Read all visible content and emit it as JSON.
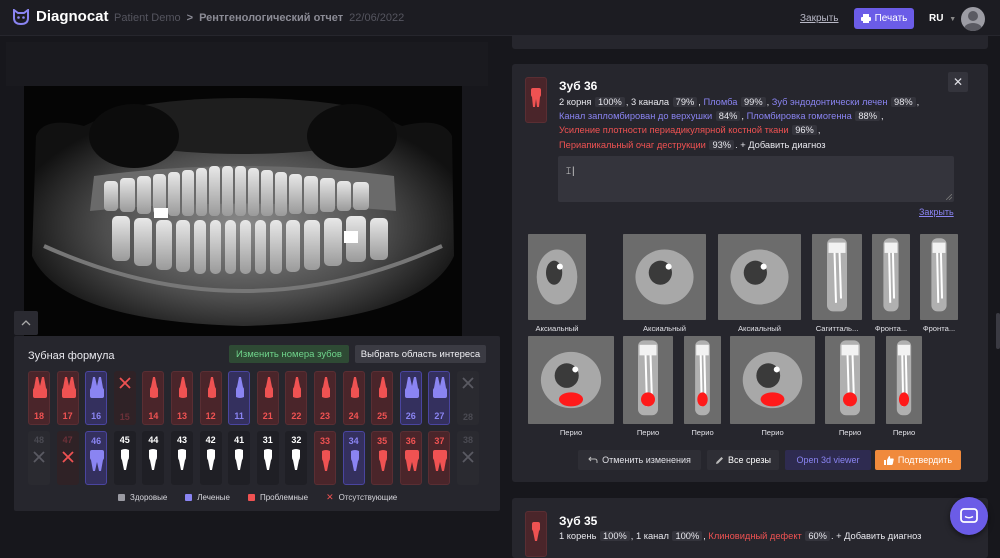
{
  "app": {
    "name": "Diagnocat"
  },
  "breadcrumb": {
    "patient": "Patient Demo",
    "separator": ">",
    "report": "Рентгенологический отчет",
    "date": "22/06/2022"
  },
  "header": {
    "close_label": "Закрыть",
    "print_label": "Печать",
    "language": "RU"
  },
  "formula": {
    "title": "Зубная формула",
    "change_numbers_label": "Изменить номера зубов",
    "select_region_label": "Выбрать область интереса",
    "upper": [
      {
        "num": "18",
        "status": "problem"
      },
      {
        "num": "17",
        "status": "problem"
      },
      {
        "num": "16",
        "status": "treated"
      },
      {
        "num": "15",
        "status": "missing"
      },
      {
        "num": "14",
        "status": "problem"
      },
      {
        "num": "13",
        "status": "problem"
      },
      {
        "num": "12",
        "status": "problem"
      },
      {
        "num": "11",
        "status": "treated"
      },
      {
        "num": "21",
        "status": "problem"
      },
      {
        "num": "22",
        "status": "problem"
      },
      {
        "num": "23",
        "status": "problem"
      },
      {
        "num": "24",
        "status": "problem"
      },
      {
        "num": "25",
        "status": "problem"
      },
      {
        "num": "26",
        "status": "treated"
      },
      {
        "num": "27",
        "status": "treated"
      },
      {
        "num": "28",
        "status": "empty"
      }
    ],
    "lower": [
      {
        "num": "48",
        "status": "empty"
      },
      {
        "num": "47",
        "status": "missing"
      },
      {
        "num": "46",
        "status": "treated"
      },
      {
        "num": "45",
        "status": "healthy"
      },
      {
        "num": "44",
        "status": "healthy"
      },
      {
        "num": "43",
        "status": "healthy"
      },
      {
        "num": "42",
        "status": "healthy"
      },
      {
        "num": "41",
        "status": "healthy"
      },
      {
        "num": "31",
        "status": "healthy"
      },
      {
        "num": "32",
        "status": "healthy"
      },
      {
        "num": "33",
        "status": "problem"
      },
      {
        "num": "34",
        "status": "treated"
      },
      {
        "num": "35",
        "status": "problem"
      },
      {
        "num": "36",
        "status": "problem"
      },
      {
        "num": "37",
        "status": "problem"
      },
      {
        "num": "38",
        "status": "empty"
      }
    ],
    "legend": {
      "healthy": "Здоровые",
      "treated": "Леченые",
      "problem": "Проблемные",
      "missing": "Отсутствующие"
    }
  },
  "colors": {
    "accent": "#6b5ce7",
    "problem": "#ef5252",
    "treated": "#8a84f2",
    "confirm": "#f08a3c",
    "green": "#6fd48b"
  },
  "tooth_card": {
    "title": "Зуб 36",
    "diagnoses": [
      {
        "text": "2 корня",
        "pct": "100%",
        "color": "white"
      },
      {
        "text": "3 канала",
        "pct": "79%",
        "color": "white"
      },
      {
        "text": "Пломба",
        "pct": "99%",
        "color": "purple"
      },
      {
        "text": "Зуб эндодонтически лечен",
        "pct": "98%",
        "color": "purple"
      },
      {
        "text": "Канал запломбирован до верхушки",
        "pct": "84%",
        "color": "purple"
      },
      {
        "text": "Пломбировка гомогенна",
        "pct": "88%",
        "color": "purple"
      },
      {
        "text": "Усиление плотности периадикулярной костной ткани",
        "pct": "96%",
        "color": "red"
      },
      {
        "text": "Периапикальный очаг деструкции",
        "pct": "93%",
        "color": "red"
      }
    ],
    "add_diagnosis": "+ Добавить диагноз",
    "comment_value": "",
    "close_link": "Закрыть",
    "slices_row1": [
      "Аксиальный",
      "Аксиальный",
      "Аксиальный",
      "Сагитталь...",
      "Фронта...",
      "Фронта..."
    ],
    "slices_row2": [
      "Перио",
      "Перио",
      "Перио",
      "Перио",
      "Перио",
      "Перио"
    ],
    "actions": {
      "undo": "Отменить изменения",
      "all_slices": "Все срезы",
      "open_3d": "Open 3d viewer",
      "confirm": "Подтвердить"
    }
  },
  "tooth_card2": {
    "title": "Зуб 35",
    "diagnoses": [
      {
        "text": "1 корень",
        "pct": "100%",
        "color": "white"
      },
      {
        "text": "1 канал",
        "pct": "100%",
        "color": "white"
      },
      {
        "text": "Клиновидный дефект",
        "pct": "60%",
        "color": "red"
      }
    ],
    "add_diagnosis": "+ Добавить диагноз"
  }
}
